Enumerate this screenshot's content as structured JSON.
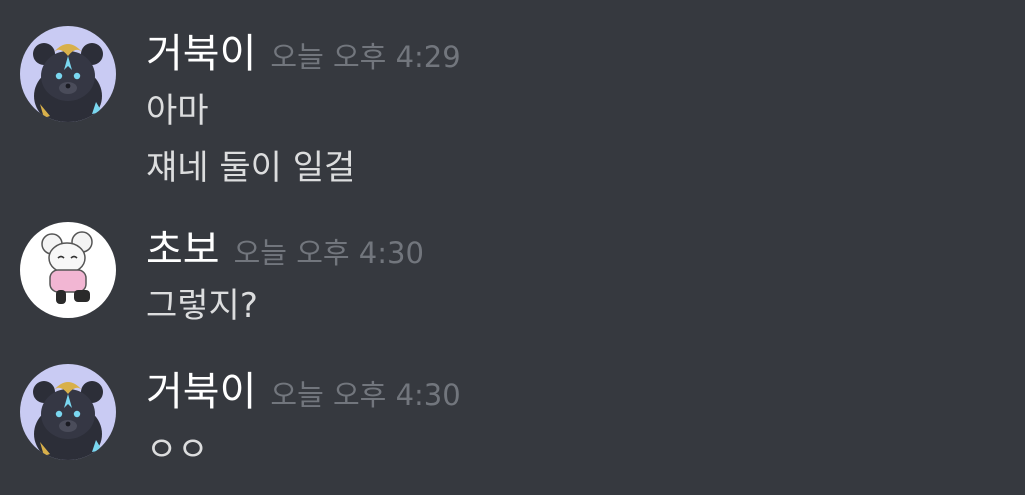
{
  "colors": {
    "background": "#36393f",
    "username": "#ffffff",
    "timestamp": "#72767d",
    "message_text": "#dcddde"
  },
  "messages": [
    {
      "author": "거북이",
      "avatar_icon": "black-bear-avatar-icon",
      "timestamp": "오늘 오후 4:29",
      "lines": [
        "아마",
        "쟤네 둘이 일걸"
      ]
    },
    {
      "author": "초보",
      "avatar_icon": "white-mouse-avatar-icon",
      "timestamp": "오늘 오후 4:30",
      "lines": [
        "그렇지?"
      ]
    },
    {
      "author": "거북이",
      "avatar_icon": "black-bear-avatar-icon",
      "timestamp": "오늘 오후 4:30",
      "lines": [
        "ㅇㅇ"
      ]
    }
  ]
}
